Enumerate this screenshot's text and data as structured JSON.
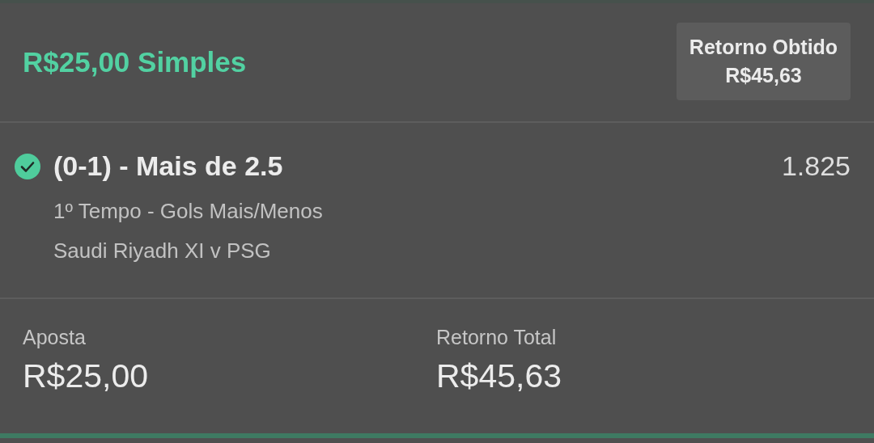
{
  "bet": {
    "title": "R$25,00 Simples",
    "returned_label": "Retorno Obtido",
    "returned_value": "R$45,63"
  },
  "selection": {
    "won": true,
    "market_pick": "(0-1) - Mais de 2.5",
    "odds": "1.825",
    "market": "1º Tempo - Gols Mais/Menos",
    "event": "Saudi Riyadh XI v PSG"
  },
  "totals": [
    {
      "label": "Aposta",
      "value": "R$25,00"
    },
    {
      "label": "Retorno Total",
      "value": "R$45,63"
    }
  ]
}
